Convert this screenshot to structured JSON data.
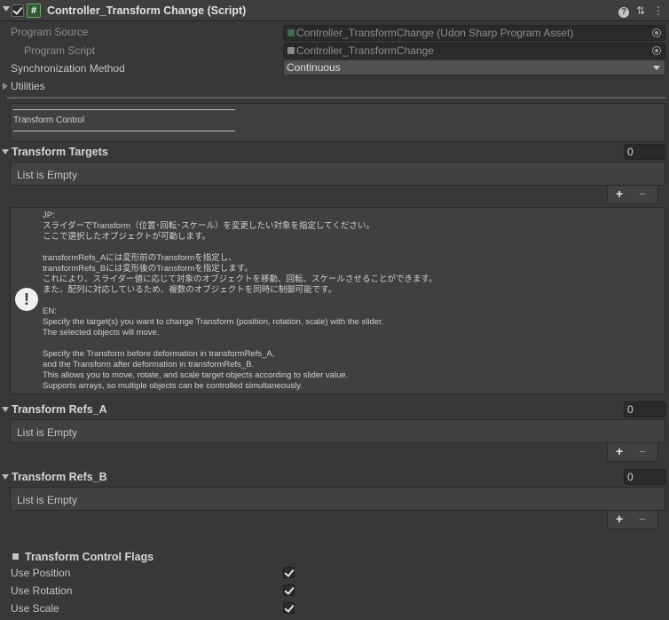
{
  "header": {
    "title": "Controller_Transform Change (Script)",
    "icon_glyph": "#",
    "help_icon": "?",
    "settings_icon": "⇅",
    "menu_icon": "⋮"
  },
  "fields": {
    "program_source_label": "Program Source",
    "program_source_value": "Controller_TransformChange (Udon Sharp Program Asset)",
    "program_script_label": "Program Script",
    "program_script_value": "Controller_TransformChange",
    "sync_method_label": "Synchronization Method",
    "sync_method_value": "Continuous",
    "utilities_label": "Utilities"
  },
  "section_header": "Transform Control",
  "lists": {
    "targets": {
      "label": "Transform Targets",
      "count": "0",
      "empty_text": "List is Empty"
    },
    "refs_a": {
      "label": "Transform Refs_A",
      "count": "0",
      "empty_text": "List is Empty"
    },
    "refs_b": {
      "label": "Transform Refs_B",
      "count": "0",
      "empty_text": "List is Empty"
    }
  },
  "list_controls": {
    "add": "+",
    "remove": "−"
  },
  "help": {
    "icon_glyph": "!",
    "text": "JP:\nスライダーでTransform（位置･回転･スケール）を変更したい対象を指定してください。\nここで選択したオブジェクトが可動します。\n\ntransformRefs_Aには変形前のTransformを指定し、\ntransformRefs_Bには変形後のTransformを指定します。\nこれにより、スライダー値に応じて対象のオブジェクトを移動、回転、スケールさせることができます。\nまた、配列に対応しているため、複数のオブジェクトを同時に制御可能です。\n\nEN:\nSpecify the target(s) you want to change Transform (position, rotation, scale) with the slider.\nThe selected objects will move.\n\nSpecify the Transform before deformation in transformRefs_A,\nand the Transform after deformation in transformRefs_B.\nThis allows you to move, rotate, and scale target objects according to slider value.\nSupports arrays, so multiple objects can be controlled simultaneously."
  },
  "flags": {
    "title": "Transform Control Flags",
    "items": [
      {
        "label": "Use Position",
        "checked": true
      },
      {
        "label": "Use Rotation",
        "checked": true
      },
      {
        "label": "Use Scale",
        "checked": true
      }
    ]
  },
  "colors": {
    "background": "#383838",
    "field_background": "#2a2a2a",
    "script_icon_green": "#2e5a2e"
  }
}
